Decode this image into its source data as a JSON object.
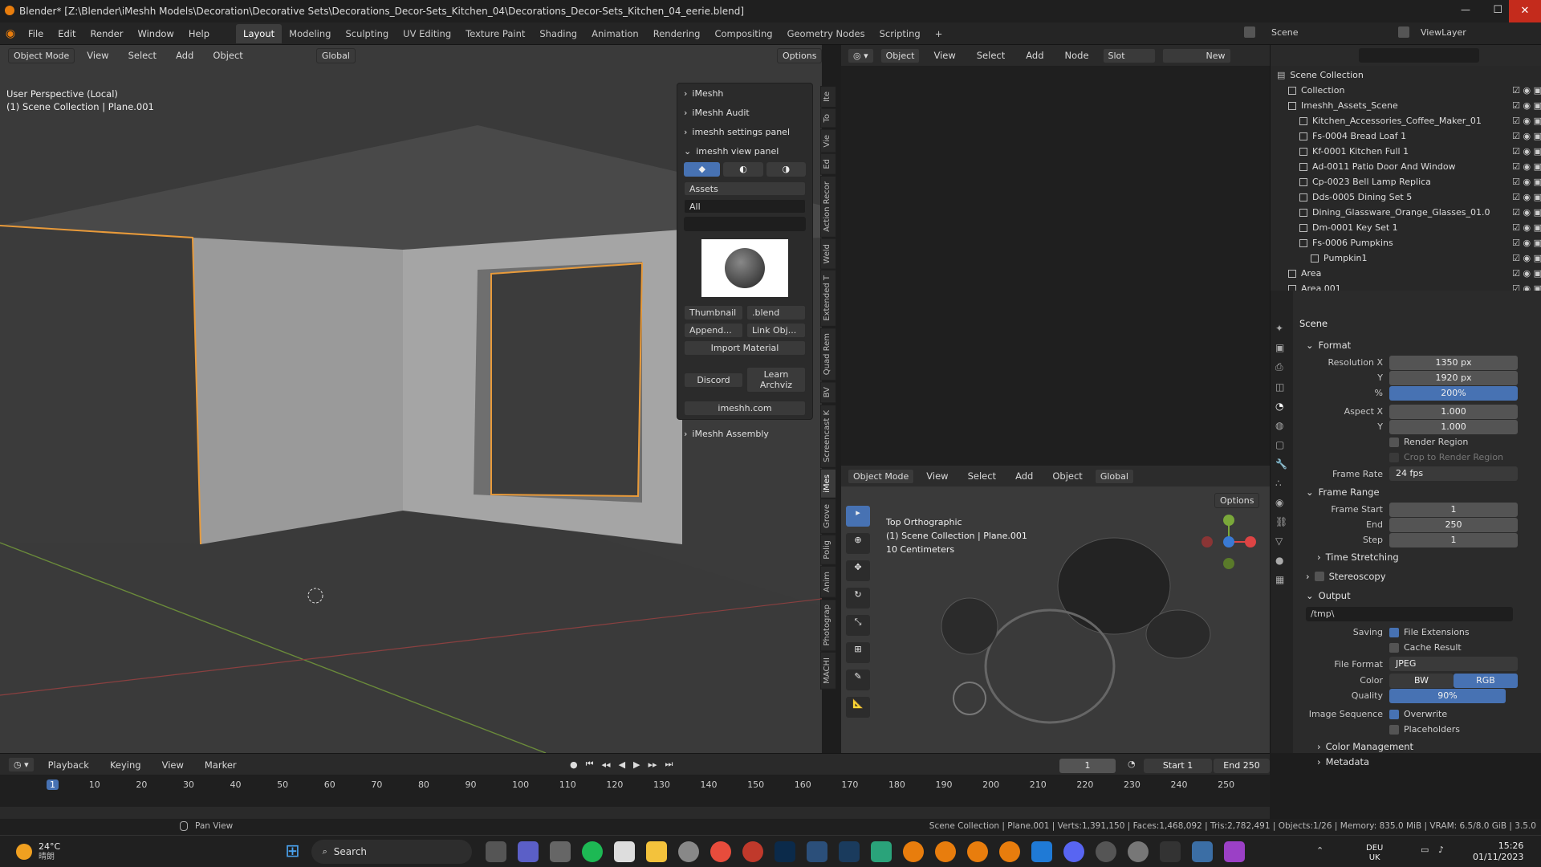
{
  "titlebar": {
    "title": "Blender* [Z:\\Blender\\iMeshh Models\\Decoration\\Decorative Sets\\Decorations_Decor-Sets_Kitchen_04\\Decorations_Decor-Sets_Kitchen_04_eerie.blend]",
    "minimize": "—",
    "maximize": "☐",
    "close": "✕"
  },
  "menu": [
    "File",
    "Edit",
    "Render",
    "Window",
    "Help"
  ],
  "workspaces": [
    "Layout",
    "Modeling",
    "Sculpting",
    "UV Editing",
    "Texture Paint",
    "Shading",
    "Animation",
    "Rendering",
    "Compositing",
    "Geometry Nodes",
    "Scripting"
  ],
  "workspace_add": "+",
  "scene": {
    "label": "Scene",
    "viewlayer": "ViewLayer"
  },
  "vp_header": {
    "mode": "Object Mode",
    "view": "View",
    "select": "Select",
    "add": "Add",
    "object": "Object",
    "orientation": "Global",
    "options": "Options"
  },
  "vp_overlay": {
    "line1": "User Perspective (Local)",
    "line2": "(1) Scene Collection | Plane.001"
  },
  "imeshh": {
    "p1": "iMeshh",
    "p2": "iMeshh Audit",
    "p3": "imeshh settings panel",
    "p4": "imeshh view panel",
    "assets": "Assets",
    "all": "All",
    "search_value": "",
    "thumbnail": "Thumbnail",
    "blend": ".blend",
    "append": "Append...",
    "link": "Link Obj...",
    "import_material": "Import Material",
    "discord": "Discord",
    "learn": "Learn Archviz",
    "site": "imeshh.com",
    "assembly": "iMeshh Assembly"
  },
  "side_tabs": [
    "Ite",
    "To",
    "Vie",
    "Ed",
    "Action Recor",
    "Weld",
    "Extended T",
    "Quad Rem",
    "BV",
    "Screencast K",
    "iMes",
    "Grove",
    "Polig",
    "Anim",
    "Photograp",
    "MACHI"
  ],
  "node_header": {
    "object": "Object",
    "view": "View",
    "select": "Select",
    "add": "Add",
    "node": "Node",
    "slot": "Slot",
    "new": "New"
  },
  "ortho": {
    "line1": "Top Orthographic",
    "line2": "(1) Scene Collection | Plane.001",
    "line3": "10 Centimeters",
    "mode": "Object Mode",
    "view": "View",
    "select": "Select",
    "add": "Add",
    "object": "Object",
    "orientation": "Global",
    "options": "Options"
  },
  "outliner": {
    "root": "Scene Collection",
    "items": [
      {
        "name": "Collection",
        "indent": 1
      },
      {
        "name": "Imeshh_Assets_Scene",
        "indent": 1
      },
      {
        "name": "Kitchen_Accessories_Coffee_Maker_01",
        "indent": 2
      },
      {
        "name": "Fs-0004 Bread Loaf 1",
        "indent": 2
      },
      {
        "name": "Kf-0001 Kitchen Full 1",
        "indent": 2
      },
      {
        "name": "Ad-0011 Patio Door And Window",
        "indent": 2
      },
      {
        "name": "Cp-0023 Bell Lamp Replica",
        "indent": 2
      },
      {
        "name": "Dds-0005 Dining Set 5",
        "indent": 2
      },
      {
        "name": "Dining_Glassware_Orange_Glasses_01.0",
        "indent": 2
      },
      {
        "name": "Dm-0001 Key Set 1",
        "indent": 2
      },
      {
        "name": "Fs-0006 Pumpkins",
        "indent": 2
      },
      {
        "name": "Pumpkin1",
        "indent": 3
      },
      {
        "name": "Area",
        "indent": 1
      },
      {
        "name": "Area.001",
        "indent": 1
      }
    ]
  },
  "props": {
    "title": "Scene",
    "format": "Format",
    "res_x_label": "Resolution X",
    "res_x": "1350 px",
    "y_label": "Y",
    "res_y": "1920 px",
    "pct_label": "%",
    "pct": "200%",
    "aspect_x_label": "Aspect X",
    "aspect_x": "1.000",
    "aspect_y": "1.000",
    "render_region": "Render Region",
    "crop": "Crop to Render Region",
    "frame_rate_label": "Frame Rate",
    "frame_rate": "24 fps",
    "frame_range": "Frame Range",
    "start_label": "Frame Start",
    "start": "1",
    "end_label": "End",
    "end": "250",
    "step_label": "Step",
    "step": "1",
    "time_stretching": "Time Stretching",
    "stereoscopy": "Stereoscopy",
    "output": "Output",
    "path": "/tmp\\",
    "saving": "Saving",
    "file_ext": "File Extensions",
    "cache": "Cache Result",
    "file_format_label": "File Format",
    "file_format": "JPEG",
    "color_label": "Color",
    "bw": "BW",
    "rgb": "RGB",
    "quality_label": "Quality",
    "quality": "90%",
    "image_seq": "Image Sequence",
    "overwrite": "Overwrite",
    "placeholders": "Placeholders",
    "color_mgmt": "Color Management",
    "metadata": "Metadata"
  },
  "timeline": {
    "playback": "Playback",
    "keying": "Keying",
    "view": "View",
    "marker": "Marker",
    "current": "1",
    "start_label": "Start",
    "start": "1",
    "end_label": "End",
    "end": "250",
    "ticks": [
      "1",
      "10",
      "20",
      "30",
      "40",
      "50",
      "60",
      "70",
      "80",
      "90",
      "100",
      "110",
      "120",
      "130",
      "140",
      "150",
      "160",
      "170",
      "180",
      "190",
      "200",
      "210",
      "220",
      "230",
      "240",
      "250"
    ]
  },
  "status": {
    "pan": "Pan View",
    "info": "Scene Collection | Plane.001 | Verts:1,391,150 | Faces:1,468,092 | Tris:2,782,491 | Objects:1/26 | Memory: 835.0 MiB | VRAM: 6.5/8.0 GiB | 3.5.0"
  },
  "taskbar": {
    "temp": "24°C",
    "weather": "晴朗",
    "search": "Search",
    "lang1": "DEU",
    "lang2": "UK",
    "time": "15:26",
    "date": "01/11/2023"
  },
  "colors": {
    "accent": "#4772b3",
    "selection": "#f0a030",
    "bg": "#3a3a3a"
  }
}
